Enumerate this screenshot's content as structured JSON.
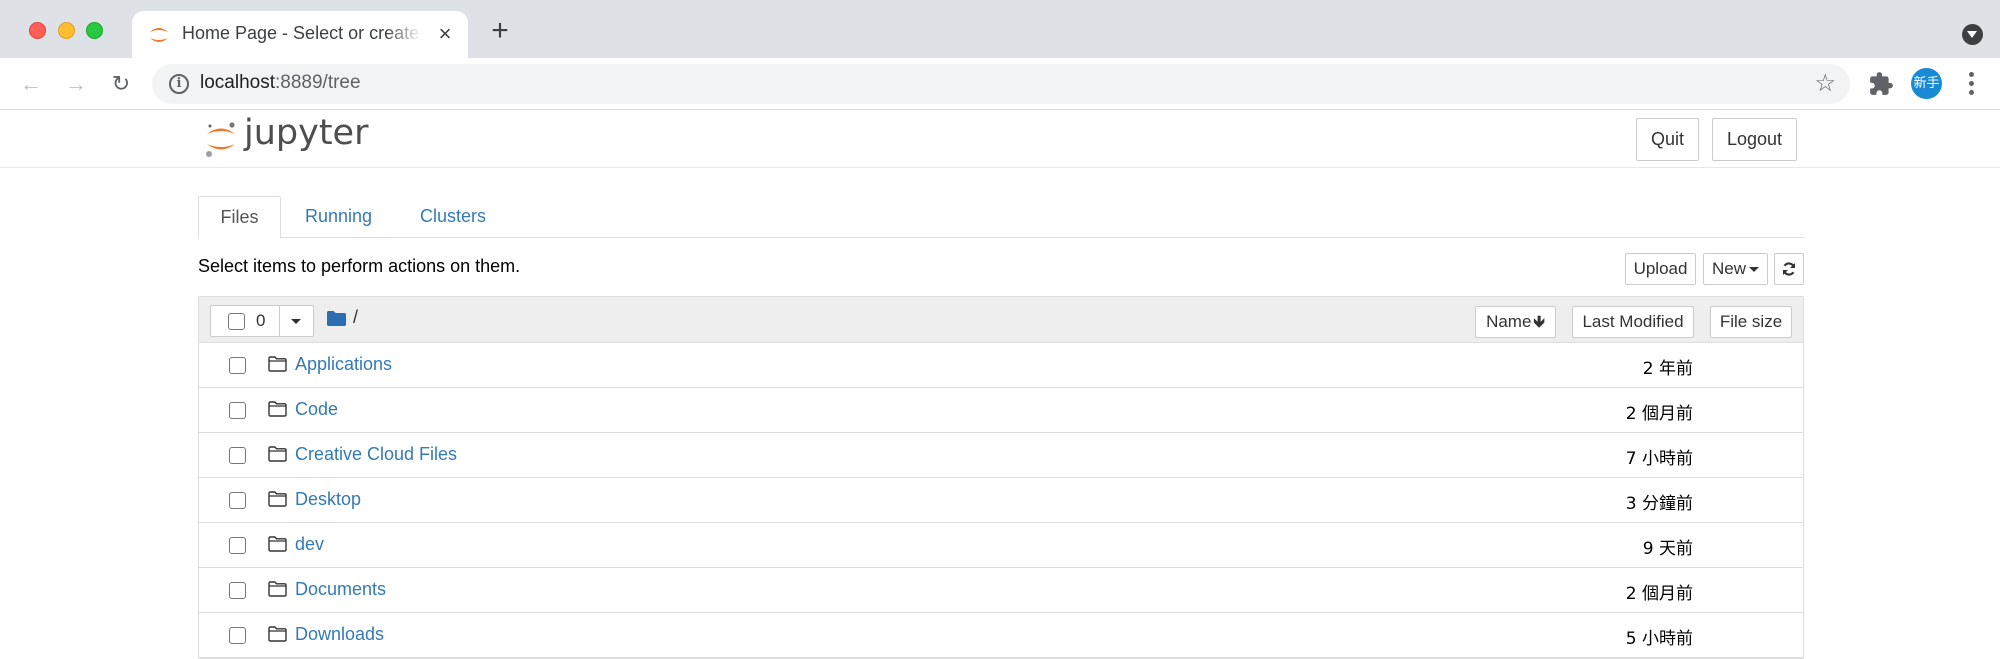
{
  "browser": {
    "tab_title": "Home Page - Select or create a notebook",
    "url_host": "localhost",
    "url_rest": ":8889/tree",
    "profile_label": "新手",
    "icons": {
      "back": "arrow-left-icon",
      "forward": "arrow-right-icon",
      "reload": "reload-icon",
      "info": "info-icon",
      "bookmark": "star-icon",
      "extensions": "puzzle-icon",
      "menu": "kebab-menu-icon",
      "tab_search": "chevron-down-circle-icon",
      "new_tab": "plus-icon",
      "close_tab": "close-icon"
    }
  },
  "header": {
    "logo_text": "jupyter",
    "quit_label": "Quit",
    "logout_label": "Logout"
  },
  "tabs": [
    {
      "label": "Files",
      "active": true
    },
    {
      "label": "Running",
      "active": false
    },
    {
      "label": "Clusters",
      "active": false
    }
  ],
  "toolbar": {
    "status_text": "Select items to perform actions on them.",
    "upload_label": "Upload",
    "new_label": "New",
    "refresh_icon": "refresh-icon"
  },
  "file_list": {
    "selected_count": "0",
    "breadcrumb": "/",
    "columns": {
      "name": "Name",
      "last_modified": "Last Modified",
      "file_size": "File size"
    },
    "sort_indicator": "arrow-down",
    "rows": [
      {
        "name": "Applications",
        "type": "folder",
        "modified": "2 年前"
      },
      {
        "name": "Code",
        "type": "folder",
        "modified": "2 個月前"
      },
      {
        "name": "Creative Cloud Files",
        "type": "folder",
        "modified": "7 小時前"
      },
      {
        "name": "Desktop",
        "type": "folder",
        "modified": "3 分鐘前"
      },
      {
        "name": "dev",
        "type": "folder",
        "modified": "9 天前"
      },
      {
        "name": "Documents",
        "type": "folder",
        "modified": "2 個月前"
      },
      {
        "name": "Downloads",
        "type": "folder",
        "modified": "5 小時前"
      }
    ]
  },
  "colors": {
    "link": "#337ab7",
    "jupyter_orange": "#f37726",
    "profile_blue": "#1a8ad4"
  }
}
